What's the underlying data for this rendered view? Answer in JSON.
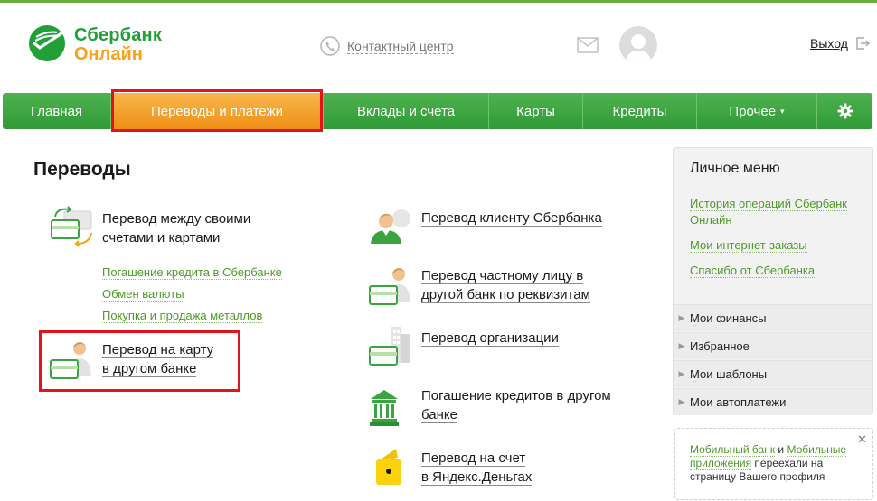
{
  "header": {
    "logo": {
      "line1": "Сбербанк",
      "line2": "Онлайн"
    },
    "contact_center": "Контактный центр",
    "logout": "Выход"
  },
  "nav": {
    "items": [
      {
        "label": "Главная"
      },
      {
        "label": "Переводы и платежи",
        "active": true
      },
      {
        "label": "Вклады и счета"
      },
      {
        "label": "Карты"
      },
      {
        "label": "Кредиты"
      },
      {
        "label": "Прочее"
      }
    ],
    "more_arrow": "▾"
  },
  "main": {
    "title": "Переводы",
    "left": [
      {
        "line1": "Перевод между своими",
        "line2": "счетами и картами",
        "sublinks": [
          "Погашение кредита в Сбербанке",
          "Обмен валюты",
          "Покупка и продажа металлов"
        ]
      },
      {
        "line1": "Перевод на карту",
        "line2": "в другом банке"
      }
    ],
    "right": [
      {
        "line1": "Перевод клиенту Сбербанка",
        "line2": ""
      },
      {
        "line1": "Перевод частному лицу в",
        "line2": "другой банк по реквизитам"
      },
      {
        "line1": "Перевод организации",
        "line2": ""
      },
      {
        "line1": "Погашение кредитов в другом",
        "line2": "банке"
      },
      {
        "line1": "Перевод на счет",
        "line2": "в Яндекс.Деньгах"
      }
    ]
  },
  "side": {
    "title": "Личное меню",
    "links": [
      "История операций Сбербанк Онлайн",
      "Мои интернет-заказы",
      "Спасибо от Сбербанка"
    ],
    "items": [
      "Мои финансы",
      "Избранное",
      "Мои шаблоны",
      "Мои автоплатежи"
    ],
    "chevron": "▶"
  },
  "note": {
    "link1": "Мобильный банк",
    "and": " и ",
    "link2": "Мобильные приложения",
    "rest": " переехали на страницу Вашего профиля",
    "close": "✕"
  },
  "colors": {
    "brand_green": "#21a038",
    "brand_orange": "#f7a21b",
    "highlight_red": "#e1141c",
    "link_green": "#4e9a29"
  }
}
